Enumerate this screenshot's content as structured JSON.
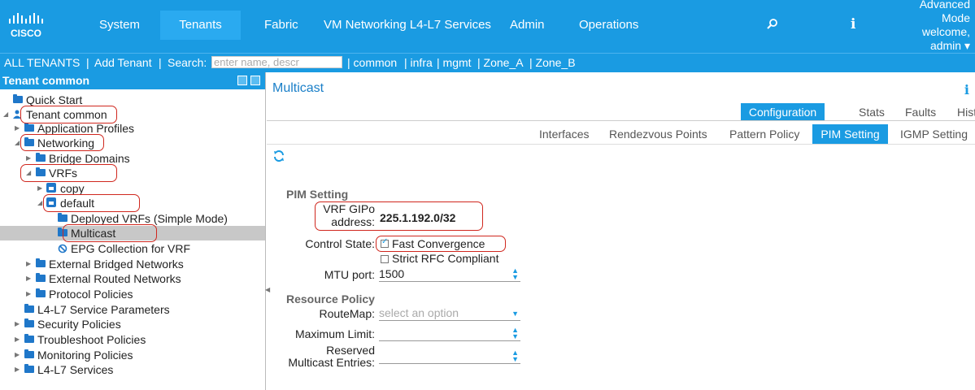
{
  "topnav": {
    "logo_text": "CISCO",
    "items": [
      {
        "label": "System"
      },
      {
        "label": "Tenants",
        "active": true
      },
      {
        "label": "Fabric"
      },
      {
        "label": "VM Networking L4-L7 Services"
      },
      {
        "label": "Admin"
      },
      {
        "label": "Operations"
      }
    ],
    "search_icon": "search-icon",
    "info_icon": "i",
    "mode_line1": "Advanced",
    "mode_line2": "Mode",
    "welcome": "welcome,",
    "user": "admin ▾"
  },
  "subnav": {
    "all_tenants": "ALL TENANTS",
    "sep1": "|",
    "add_tenant": "Add Tenant",
    "sep2": "|",
    "search_label": "Search:",
    "search_placeholder": "enter name, descr",
    "quick": [
      "| common",
      "| infra",
      "| mgmt",
      "| Zone_A",
      "| Zone_B"
    ]
  },
  "tree": {
    "header": "Tenant common",
    "rows": [
      {
        "label": "Quick Start",
        "icon": "folder-icon"
      },
      {
        "label": "Tenant common",
        "icon": "tenant-icon",
        "expanded": true
      },
      {
        "label": "Application Profiles",
        "icon": "folder-icon"
      },
      {
        "label": "Networking",
        "icon": "folder-icon",
        "expanded": true
      },
      {
        "label": "Bridge Domains",
        "icon": "folder-icon"
      },
      {
        "label": "VRFs",
        "icon": "folder-icon",
        "expanded": true
      },
      {
        "label": "copy",
        "icon": "vrf-icon"
      },
      {
        "label": "default",
        "icon": "vrf-icon",
        "expanded": true
      },
      {
        "label": "Deployed VRFs (Simple Mode)",
        "icon": "folder-icon"
      },
      {
        "label": "Multicast",
        "icon": "folder-icon",
        "selected": true
      },
      {
        "label": "EPG Collection for VRF",
        "icon": "no-entry-icon"
      },
      {
        "label": "External Bridged Networks",
        "icon": "folder-icon"
      },
      {
        "label": "External Routed Networks",
        "icon": "folder-icon"
      },
      {
        "label": "Protocol Policies",
        "icon": "folder-icon"
      },
      {
        "label": "L4-L7 Service Parameters",
        "icon": "folder-icon"
      },
      {
        "label": "Security Policies",
        "icon": "folder-icon"
      },
      {
        "label": "Troubleshoot Policies",
        "icon": "folder-icon"
      },
      {
        "label": "Monitoring Policies",
        "icon": "folder-icon"
      },
      {
        "label": "L4-L7 Services",
        "icon": "folder-icon"
      }
    ]
  },
  "content": {
    "title": "Multicast",
    "info_icon": "i",
    "primary_tabs": [
      {
        "label": "Configuration",
        "active": true
      },
      {
        "label": "Stats"
      },
      {
        "label": "Faults"
      },
      {
        "label": "History"
      }
    ],
    "secondary_tabs": [
      {
        "label": "Interfaces"
      },
      {
        "label": "Rendezvous Points"
      },
      {
        "label": "Pattern Policy"
      },
      {
        "label": "PIM Setting",
        "active": true
      },
      {
        "label": "IGMP Setting"
      }
    ],
    "pim": {
      "section_title": "PIM Setting",
      "gipo_label_1": "VRF GIPo",
      "gipo_label_2": "address:",
      "gipo_value": "225.1.192.0/32",
      "control_state_label": "Control State:",
      "fast_convergence": "Fast Convergence",
      "fast_convergence_checked": true,
      "strict_rfc": "Strict RFC Compliant",
      "strict_rfc_checked": false,
      "mtu_label": "MTU port:",
      "mtu_value": "1500"
    },
    "resource": {
      "section_title": "Resource Policy",
      "routemap_label": "RouteMap:",
      "routemap_placeholder": "select an option",
      "max_limit_label": "Maximum Limit:",
      "max_limit_value": "",
      "reserved_label_1": "Reserved",
      "reserved_label_2": "Multicast Entries:",
      "reserved_value": ""
    }
  },
  "colors": {
    "brand_blue": "#1a9be2",
    "highlight_red": "#d0271e",
    "folder_blue": "#1f77c9"
  }
}
